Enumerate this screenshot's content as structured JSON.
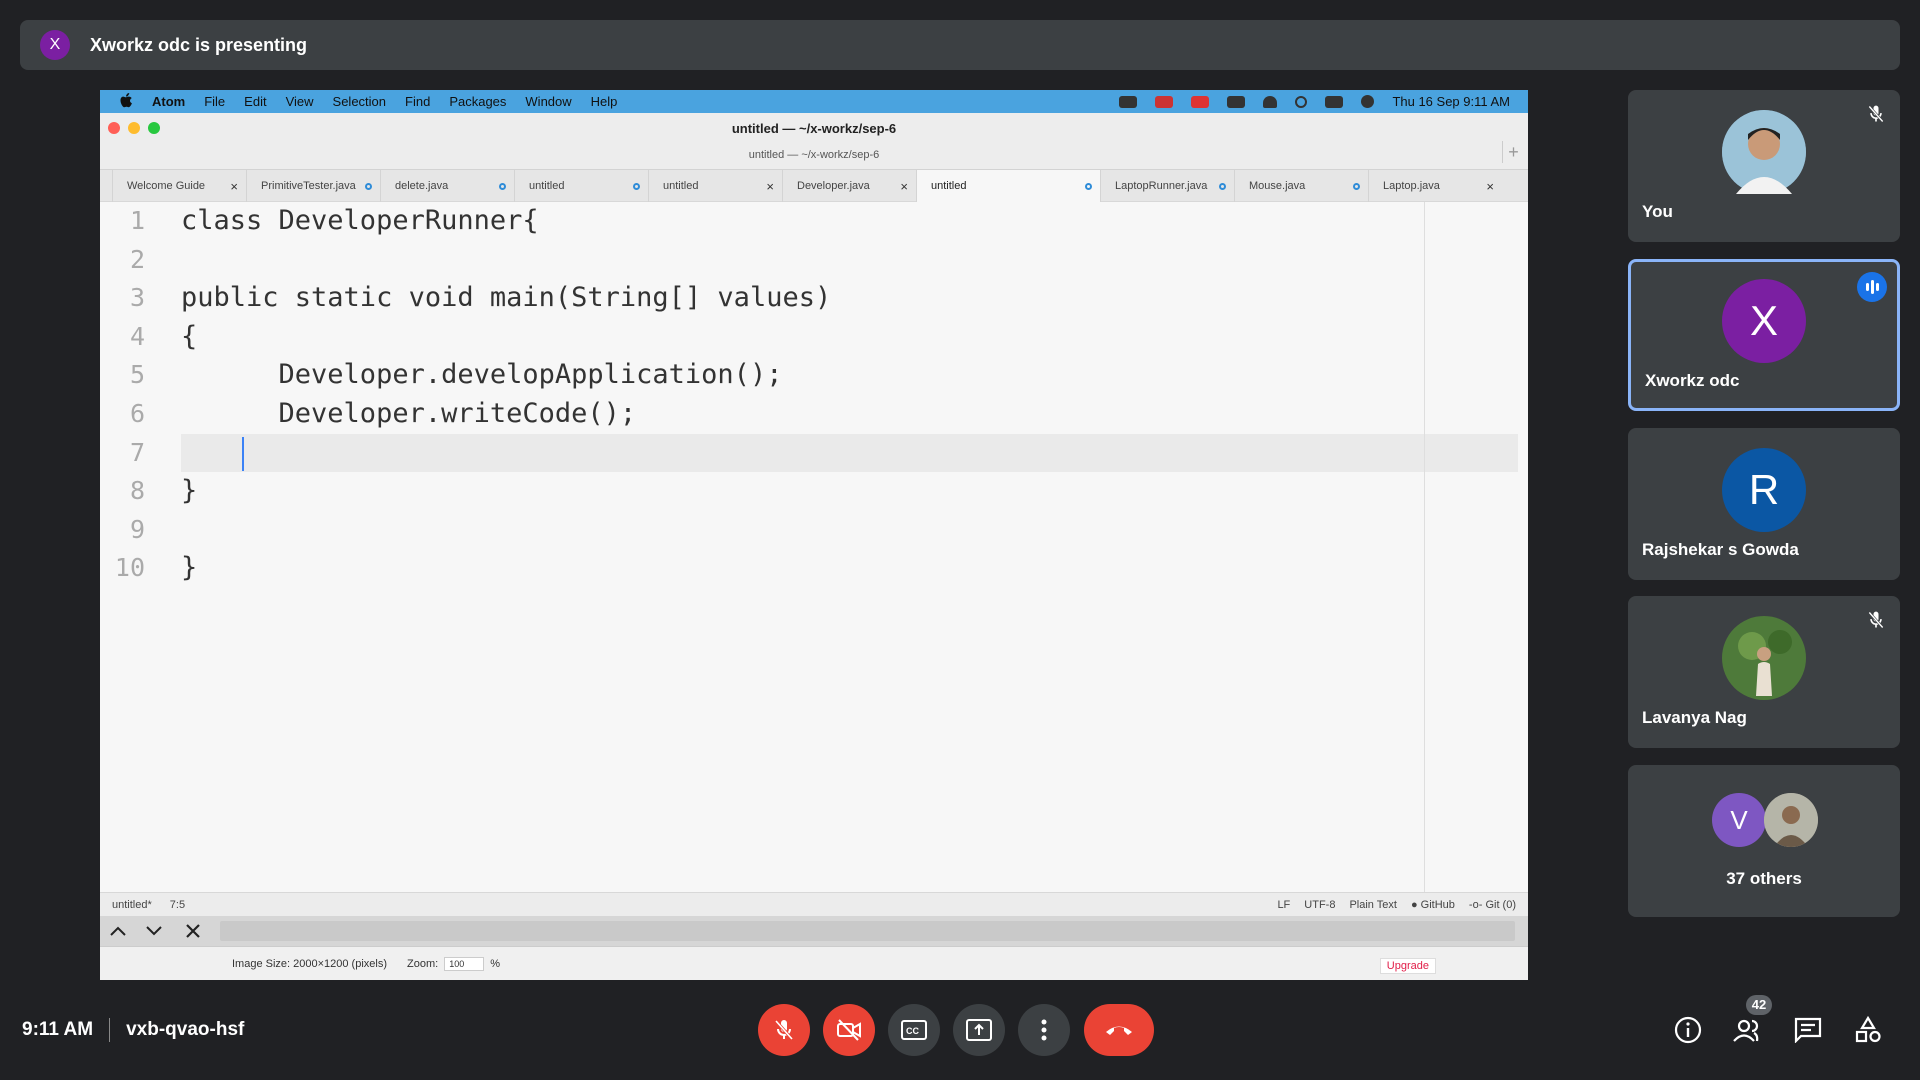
{
  "banner": {
    "avatar_letter": "X",
    "text": "Xworkz odc is presenting"
  },
  "mac_menu": {
    "apple": "",
    "items": [
      "Atom",
      "File",
      "Edit",
      "View",
      "Selection",
      "Find",
      "Packages",
      "Window",
      "Help"
    ],
    "clock": "Thu 16 Sep  9:11 AM"
  },
  "window": {
    "title": "untitled — ~/x-workz/sep-6",
    "subtitle": "untitled — ~/x-workz/sep-6",
    "new_tab": "+"
  },
  "tabs": [
    {
      "label": "Welcome Guide",
      "state": "close"
    },
    {
      "label": "PrimitiveTester.java",
      "state": "modified"
    },
    {
      "label": "delete.java",
      "state": "modified"
    },
    {
      "label": "untitled",
      "state": "modified"
    },
    {
      "label": "untitled",
      "state": "close"
    },
    {
      "label": "Developer.java",
      "state": "close"
    },
    {
      "label": "untitled",
      "state": "modified",
      "active": true
    },
    {
      "label": "LaptopRunner.java",
      "state": "modified"
    },
    {
      "label": "Mouse.java",
      "state": "modified"
    },
    {
      "label": "Laptop.java",
      "state": "close"
    }
  ],
  "code": {
    "line_numbers": [
      "1",
      "2",
      "3",
      "4",
      "5",
      "6",
      "7",
      "8",
      "9",
      "10"
    ],
    "lines": [
      "class DeveloperRunner{",
      "",
      "public static void main(String[] values)",
      "{",
      "      Developer.developApplication();",
      "      Developer.writeCode();",
      "",
      "}",
      "",
      "}"
    ]
  },
  "status": {
    "file": "untitled*",
    "position": "7:5",
    "line_ending": "LF",
    "encoding": "UTF-8",
    "grammar": "Plain Text",
    "github": "GitHub",
    "git": "Git (0)"
  },
  "viewer": {
    "image_size": "Image Size: 2000×1200 (pixels)",
    "zoom_label": "Zoom:",
    "zoom_value": "100",
    "percent": "%",
    "upgrade": "Upgrade"
  },
  "participants": [
    {
      "name": "You",
      "muted": true
    },
    {
      "name": "Xworkz odc",
      "letter": "X",
      "color": "#7b1fa2",
      "speaking": true
    },
    {
      "name": "Rajshekar s Gowda",
      "letter": "R",
      "color": "#0b57a4"
    },
    {
      "name": "Lavanya Nag",
      "muted": true
    }
  ],
  "others": {
    "letter": "V",
    "color": "#7e57c2",
    "label": "37 others"
  },
  "meeting": {
    "time": "9:11 AM",
    "code": "vxb-qvao-hsf"
  },
  "people_count": "42",
  "colors": {
    "accent": "#8ab4f8",
    "danger": "#ea4335",
    "tile": "#3c4043",
    "background": "#202124"
  }
}
